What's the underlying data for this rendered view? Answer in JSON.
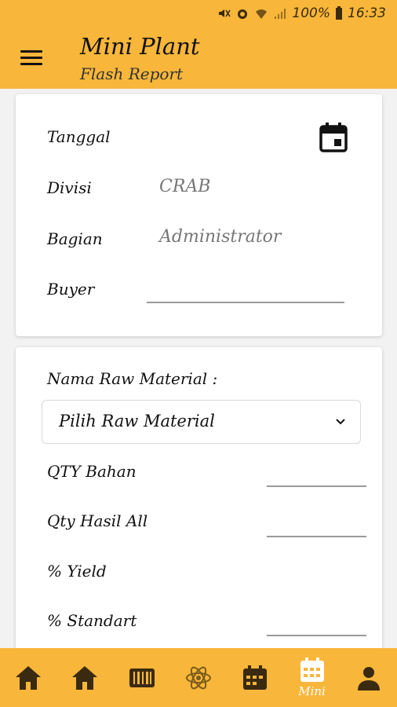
{
  "status_bar": {
    "battery": "100%",
    "time": "16:33"
  },
  "header": {
    "title": "Mini Plant",
    "subtitle": "Flash Report"
  },
  "card1": {
    "tanggal_label": "Tanggal",
    "divisi_label": "Divisi",
    "divisi_value": "CRAB",
    "bagian_label": "Bagian",
    "bagian_value": "Administrator",
    "buyer_label": "Buyer",
    "buyer_value": ""
  },
  "card2": {
    "raw_material_label": "Nama Raw Material :",
    "raw_material_selected": "Pilih Raw Material",
    "qty_bahan_label": "QTY Bahan",
    "qty_hasil_label": "Qty Hasil All",
    "yield_label": "% Yield",
    "standart_label": "% Standart"
  },
  "bottom_nav": {
    "items": [
      {
        "icon": "home-icon",
        "label": ""
      },
      {
        "icon": "home-icon",
        "label": ""
      },
      {
        "icon": "barcode-icon",
        "label": ""
      },
      {
        "icon": "atom-icon",
        "label": ""
      },
      {
        "icon": "calendar-icon",
        "label": ""
      },
      {
        "icon": "calendar-grid-icon",
        "label": "Mini"
      },
      {
        "icon": "person-icon",
        "label": ""
      }
    ],
    "active_index": 5
  },
  "colors": {
    "accent": "#f8b63a",
    "nav_icon": "#3a2a10",
    "active": "#ffffff"
  }
}
